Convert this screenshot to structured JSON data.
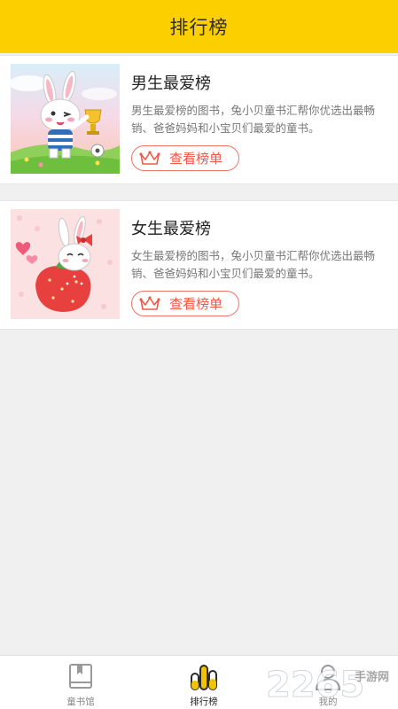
{
  "header": {
    "title": "排行榜"
  },
  "rankings": [
    {
      "title": "男生最爱榜",
      "description": "男生最爱榜的图书，兔小贝童书汇帮你优选出最畅销、爸爸妈妈和小宝贝们最爱的童书。",
      "button_label": "查看榜单",
      "thumb_icon": "boy-bunny-trophy-illustration"
    },
    {
      "title": "女生最爱榜",
      "description": "女生最爱榜的图书，兔小贝童书汇帮你优选出最畅销、爸爸妈妈和小宝贝们最爱的童书。",
      "button_label": "查看榜单",
      "thumb_icon": "girl-bunny-strawberry-illustration"
    }
  ],
  "tabs": [
    {
      "label": "童书馆",
      "icon": "book-icon",
      "active": false
    },
    {
      "label": "排行榜",
      "icon": "bar-chart-icon",
      "active": true
    },
    {
      "label": "我的",
      "icon": "user-icon",
      "active": false
    }
  ],
  "watermark": {
    "number": "2265",
    "suffix": "手游网"
  },
  "colors": {
    "header_bg": "#fcd000",
    "accent_red": "#ee5a4a",
    "tab_active": "#f2c300",
    "page_bg": "#f0f0f0"
  }
}
